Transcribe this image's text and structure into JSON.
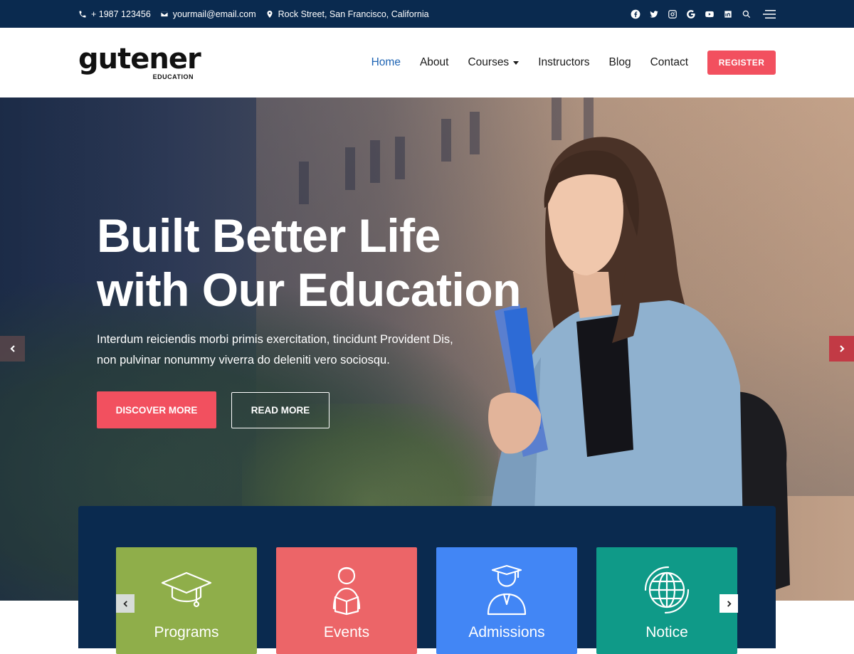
{
  "topbar": {
    "phone": "+ 1987 123456",
    "email": "yourmail@email.com",
    "address": "Rock Street, San Francisco, California",
    "social_icons": [
      "facebook-icon",
      "twitter-icon",
      "instagram-icon",
      "google-icon",
      "youtube-icon",
      "linkedin-icon",
      "search-icon",
      "hamburger-menu-icon"
    ]
  },
  "header": {
    "logo": {
      "word": "gutener",
      "sub": "EDUCATION"
    },
    "nav": [
      {
        "label": "Home",
        "active": true
      },
      {
        "label": "About"
      },
      {
        "label": "Courses",
        "has_dropdown": true
      },
      {
        "label": "Instructors"
      },
      {
        "label": "Blog"
      },
      {
        "label": "Contact"
      }
    ],
    "register_label": "REGISTER"
  },
  "hero": {
    "title_line1": "Built Better Life",
    "title_line2": "with Our Education",
    "description": "Interdum reiciendis morbi primis exercitation, tincidunt Provident Dis, non pulvinar nonummy viverra do deleniti vero sociosqu.",
    "discover_label": "DISCOVER MORE",
    "read_label": "READ MORE"
  },
  "cards": [
    {
      "label": "Programs",
      "icon": "graduation-cap-icon",
      "color": "#8fae4a"
    },
    {
      "label": "Events",
      "icon": "student-reading-icon",
      "color": "#ec6568"
    },
    {
      "label": "Admissions",
      "icon": "graduate-icon",
      "color": "#4286f5"
    },
    {
      "label": "Notice",
      "icon": "globe-icon",
      "color": "#0f9a88"
    }
  ],
  "colors": {
    "topbar_bg": "#0a2a4f",
    "accent": "#f2505f",
    "nav_active": "#1e64b4",
    "panel_bg": "#0a2a4f"
  }
}
